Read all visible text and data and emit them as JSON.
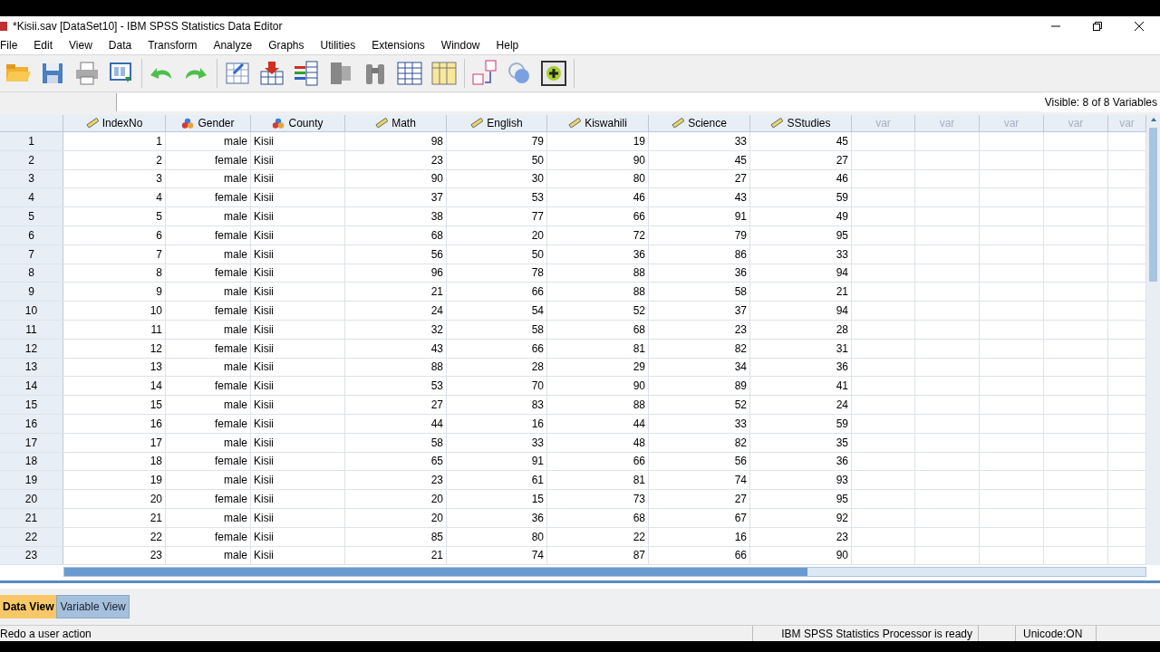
{
  "window": {
    "title": "*Kisii.sav [DataSet10] - IBM SPSS Statistics Data Editor"
  },
  "menu": [
    "File",
    "Edit",
    "View",
    "Data",
    "Transform",
    "Analyze",
    "Graphs",
    "Utilities",
    "Extensions",
    "Window",
    "Help"
  ],
  "visible_label": "Visible: 8 of 8 Variables",
  "table": {
    "columns": [
      {
        "name": "IndexNo",
        "kind": "scale"
      },
      {
        "name": "Gender",
        "kind": "nominal"
      },
      {
        "name": "County",
        "kind": "string"
      },
      {
        "name": "Math",
        "kind": "scale"
      },
      {
        "name": "English",
        "kind": "scale"
      },
      {
        "name": "Kiswahili",
        "kind": "scale"
      },
      {
        "name": "Science",
        "kind": "scale"
      },
      {
        "name": "SStudies",
        "kind": "scale"
      },
      {
        "name": "var",
        "kind": "empty"
      },
      {
        "name": "var",
        "kind": "empty"
      },
      {
        "name": "var",
        "kind": "empty"
      },
      {
        "name": "var",
        "kind": "empty"
      },
      {
        "name": "var",
        "kind": "empty"
      }
    ],
    "rows": [
      {
        "label": "1",
        "cells": [
          "1",
          "male",
          "Kisii",
          "98",
          "79",
          "19",
          "33",
          "45"
        ]
      },
      {
        "label": "2",
        "cells": [
          "2",
          "female",
          "Kisii",
          "23",
          "50",
          "90",
          "45",
          "27"
        ]
      },
      {
        "label": "3",
        "cells": [
          "3",
          "male",
          "Kisii",
          "90",
          "30",
          "80",
          "27",
          "46"
        ]
      },
      {
        "label": "4",
        "cells": [
          "4",
          "female",
          "Kisii",
          "37",
          "53",
          "46",
          "43",
          "59"
        ]
      },
      {
        "label": "5",
        "cells": [
          "5",
          "male",
          "Kisii",
          "38",
          "77",
          "66",
          "91",
          "49"
        ]
      },
      {
        "label": "6",
        "cells": [
          "6",
          "female",
          "Kisii",
          "68",
          "20",
          "72",
          "79",
          "95"
        ]
      },
      {
        "label": "7",
        "cells": [
          "7",
          "male",
          "Kisii",
          "56",
          "50",
          "36",
          "86",
          "33"
        ]
      },
      {
        "label": "8",
        "cells": [
          "8",
          "female",
          "Kisii",
          "96",
          "78",
          "88",
          "36",
          "94"
        ]
      },
      {
        "label": "9",
        "cells": [
          "9",
          "male",
          "Kisii",
          "21",
          "66",
          "88",
          "58",
          "21"
        ]
      },
      {
        "label": "10",
        "cells": [
          "10",
          "female",
          "Kisii",
          "24",
          "54",
          "52",
          "37",
          "94"
        ]
      },
      {
        "label": "11",
        "cells": [
          "11",
          "male",
          "Kisii",
          "32",
          "58",
          "68",
          "23",
          "28"
        ]
      },
      {
        "label": "12",
        "cells": [
          "12",
          "female",
          "Kisii",
          "43",
          "66",
          "81",
          "82",
          "31"
        ]
      },
      {
        "label": "13",
        "cells": [
          "13",
          "male",
          "Kisii",
          "88",
          "28",
          "29",
          "34",
          "36"
        ]
      },
      {
        "label": "14",
        "cells": [
          "14",
          "female",
          "Kisii",
          "53",
          "70",
          "90",
          "89",
          "41"
        ]
      },
      {
        "label": "15",
        "cells": [
          "15",
          "male",
          "Kisii",
          "27",
          "83",
          "88",
          "52",
          "24"
        ]
      },
      {
        "label": "16",
        "cells": [
          "16",
          "female",
          "Kisii",
          "44",
          "16",
          "44",
          "33",
          "59"
        ]
      },
      {
        "label": "17",
        "cells": [
          "17",
          "male",
          "Kisii",
          "58",
          "33",
          "48",
          "82",
          "35"
        ]
      },
      {
        "label": "18",
        "cells": [
          "18",
          "female",
          "Kisii",
          "65",
          "91",
          "66",
          "56",
          "36"
        ]
      },
      {
        "label": "19",
        "cells": [
          "19",
          "male",
          "Kisii",
          "23",
          "61",
          "81",
          "74",
          "93"
        ]
      },
      {
        "label": "20",
        "cells": [
          "20",
          "female",
          "Kisii",
          "20",
          "15",
          "73",
          "27",
          "95"
        ]
      },
      {
        "label": "21",
        "cells": [
          "21",
          "male",
          "Kisii",
          "20",
          "36",
          "68",
          "67",
          "92"
        ]
      },
      {
        "label": "22",
        "cells": [
          "22",
          "female",
          "Kisii",
          "85",
          "80",
          "22",
          "16",
          "23"
        ]
      },
      {
        "label": "23",
        "cells": [
          "23",
          "male",
          "Kisii",
          "21",
          "74",
          "87",
          "66",
          "90"
        ]
      }
    ]
  },
  "view_tabs": [
    {
      "label": "Data View",
      "selected": true
    },
    {
      "label": "Variable View",
      "selected": false
    }
  ],
  "status_bar": {
    "message": "Redo a user action",
    "processor": "IBM SPSS Statistics Processor is ready",
    "unicode": "Unicode:ON"
  }
}
